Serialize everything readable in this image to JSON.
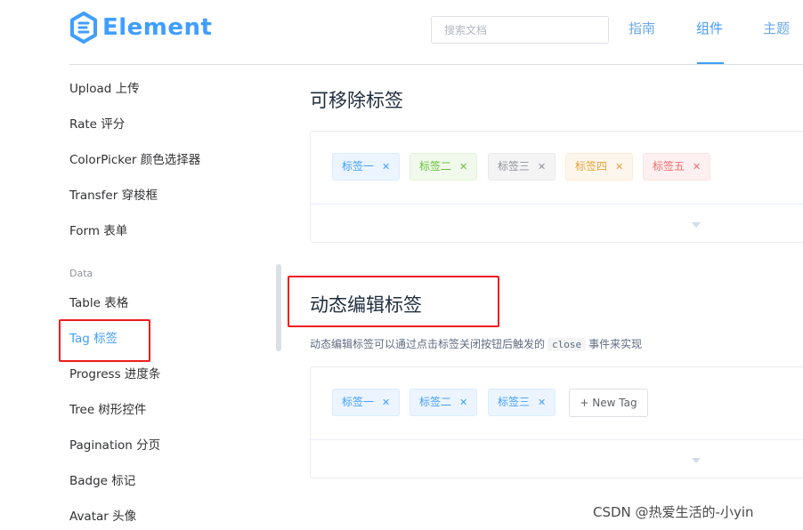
{
  "header": {
    "logo_text": "Element",
    "search_placeholder": "搜索文档",
    "nav": [
      {
        "label": "指南"
      },
      {
        "label": "组件"
      },
      {
        "label": "主题"
      }
    ]
  },
  "sidebar": {
    "items": [
      {
        "label": "Upload 上传"
      },
      {
        "label": "Rate 评分"
      },
      {
        "label": "ColorPicker 颜色选择器"
      },
      {
        "label": "Transfer 穿梭框"
      },
      {
        "label": "Form 表单"
      }
    ],
    "group_label": "Data",
    "data_items": [
      {
        "label": "Table 表格"
      },
      {
        "label": "Tag 标签"
      },
      {
        "label": "Progress 进度条"
      },
      {
        "label": "Tree 树形控件"
      },
      {
        "label": "Pagination 分页"
      },
      {
        "label": "Badge 标记"
      },
      {
        "label": "Avatar 头像"
      }
    ],
    "active_item": "Tag 标签"
  },
  "main": {
    "removable": {
      "title": "可移除标签",
      "tags": [
        {
          "label": "标签一",
          "type": "primary"
        },
        {
          "label": "标签二",
          "type": "success"
        },
        {
          "label": "标签三",
          "type": "info"
        },
        {
          "label": "标签四",
          "type": "warning"
        },
        {
          "label": "标签五",
          "type": "danger"
        }
      ]
    },
    "dynamic": {
      "title": "动态编辑标签",
      "desc_before": "动态编辑标签可以通过点击标签关闭按钮后触发的",
      "desc_code": "close",
      "desc_after": "事件来实现",
      "tags": [
        {
          "label": "标签一"
        },
        {
          "label": "标签二"
        },
        {
          "label": "标签三"
        }
      ],
      "new_tag_label": "+ New Tag"
    },
    "close_glyph": "✕"
  },
  "watermark": "CSDN @热爱生活的-小yin",
  "colors": {
    "accent": "#409eff",
    "annotation_red": "#ee1d1d"
  }
}
